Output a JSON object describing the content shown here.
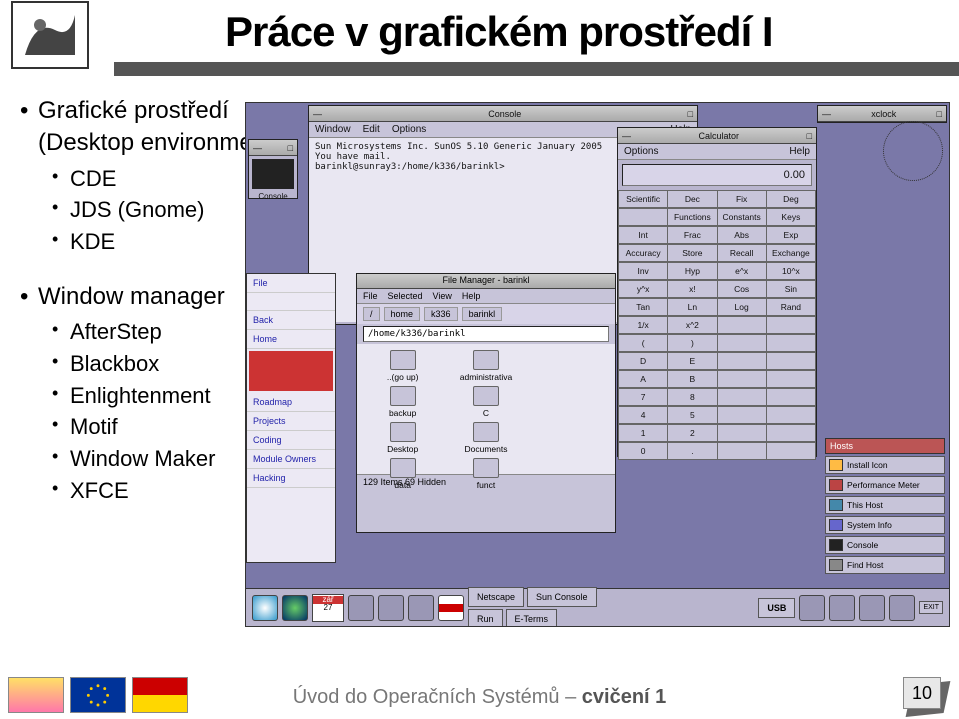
{
  "title": "Práce v grafickém prostředí I",
  "bullets": {
    "de_heading": "Grafické prostředí (Desktop environment)",
    "de_items": [
      "CDE",
      "JDS (Gnome)",
      "KDE"
    ],
    "wm_heading": "Window manager",
    "wm_items": [
      "AfterStep",
      "Blackbox",
      "Enlightenment",
      "Motif",
      "Window Maker",
      "XFCE"
    ]
  },
  "screenshot": {
    "console": {
      "title": "Console",
      "menu": [
        "Window",
        "Edit",
        "Options"
      ],
      "help": "Help",
      "lines": {
        "l1": "Sun Microsystems Inc.   SunOS 5.10      Generic January 2005",
        "l2": "You have mail.",
        "l3": "barinkl@sunray3:/home/k336/barinkl>"
      }
    },
    "xclock": {
      "title": "xclock"
    },
    "calc": {
      "title": "Calculator",
      "menu_left": "Options",
      "menu_right": "Help",
      "display": "0.00",
      "row_top": [
        "Scientific",
        "Dec",
        "Fix",
        "Deg"
      ],
      "rows": [
        [
          "",
          "Functions",
          "Constants",
          "Keys"
        ],
        [
          "Int",
          "Frac",
          "Abs",
          "Exp"
        ],
        [
          "Accuracy",
          "Store",
          "Recall",
          "Exchange"
        ],
        [
          "Inv",
          "Hyp",
          "e^x",
          "10^x"
        ],
        [
          "y^x",
          "x!",
          "Cos",
          "Sin"
        ],
        [
          "Tan",
          "Ln",
          "Log",
          "Rand"
        ],
        [
          "1/x",
          "x^2",
          "",
          ""
        ],
        [
          "(",
          ")",
          "",
          ""
        ],
        [
          "D",
          "E",
          "",
          ""
        ],
        [
          "A",
          "B",
          "",
          ""
        ],
        [
          "7",
          "8",
          "",
          ""
        ],
        [
          "4",
          "5",
          "",
          ""
        ],
        [
          "1",
          "2",
          "",
          ""
        ],
        [
          "0",
          ".",
          "",
          ""
        ]
      ]
    },
    "filemgr": {
      "title": "File Manager - barinkl",
      "menu": [
        "File",
        "Selected",
        "View"
      ],
      "help": "Help",
      "path": [
        "/",
        "home",
        "k336",
        "barinkl"
      ],
      "loc": "/home/k336/barinkl",
      "files": {
        "goup": "..(go up)",
        "admin": "administrativa",
        "backup": "backup",
        "c": "C",
        "desktop": "Desktop",
        "documents": "Documents",
        "data": "data",
        "funct": "funct"
      },
      "status": "129 Items 69 Hidden"
    },
    "leftwin": {
      "items_top": [
        "File",
        "",
        "Back",
        "Home"
      ],
      "items_mid": [
        "Roadmap",
        "Projects",
        "Coding",
        "Module Owners",
        "Hacking"
      ]
    },
    "console_label": "Console",
    "hosts": {
      "title": "Hosts",
      "items": [
        "Install Icon",
        "Performance Meter",
        "This Host",
        "System Info",
        "Console",
        "Find Host"
      ]
    },
    "taskbar": {
      "cal_month": "zář",
      "cal_day": "27",
      "buttons": [
        "Netscape",
        "Sun Console",
        "Run",
        "E-Terms"
      ],
      "usb": "USB",
      "exit": "EXIT"
    }
  },
  "footer": {
    "text_plain": "Úvod do Operačních Systémů – ",
    "text_bold": "cvičení 1",
    "page": "10"
  }
}
